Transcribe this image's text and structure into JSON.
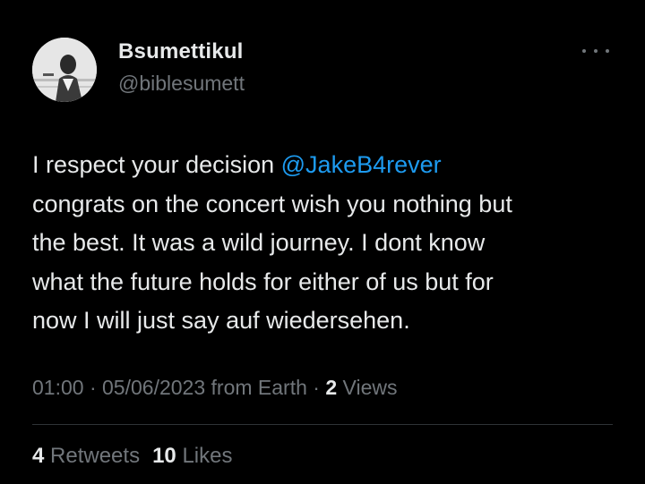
{
  "user": {
    "display_name": "Bsumettikul",
    "handle": "@biblesumett"
  },
  "icons": {
    "more": "more-horizontal-icon",
    "avatar": "profile-photo"
  },
  "tweet": {
    "text_before_mention": "I respect your decision ",
    "mention": "@JakeB4rever",
    "line2": "congrats on the concert wish you nothing but",
    "line3": "the best. It was a wild journey. I dont know",
    "line4": "what the future holds for either of us but for",
    "line5": "now I will just say auf wiedersehen."
  },
  "meta": {
    "time": "01:00",
    "separator1": " · ",
    "date": "05/06/2023",
    "source": " from Earth",
    "separator2": " · ",
    "views_count": "2",
    "views_label": " Views"
  },
  "stats": {
    "retweets_count": "4",
    "retweets_label": " Retweets",
    "likes_count": "10",
    "likes_label": " Likes"
  },
  "colors": {
    "background": "#000000",
    "primary_text": "#e7e9ea",
    "secondary_text": "#71767b",
    "link": "#1d9bf0",
    "divider": "#2f3336"
  }
}
